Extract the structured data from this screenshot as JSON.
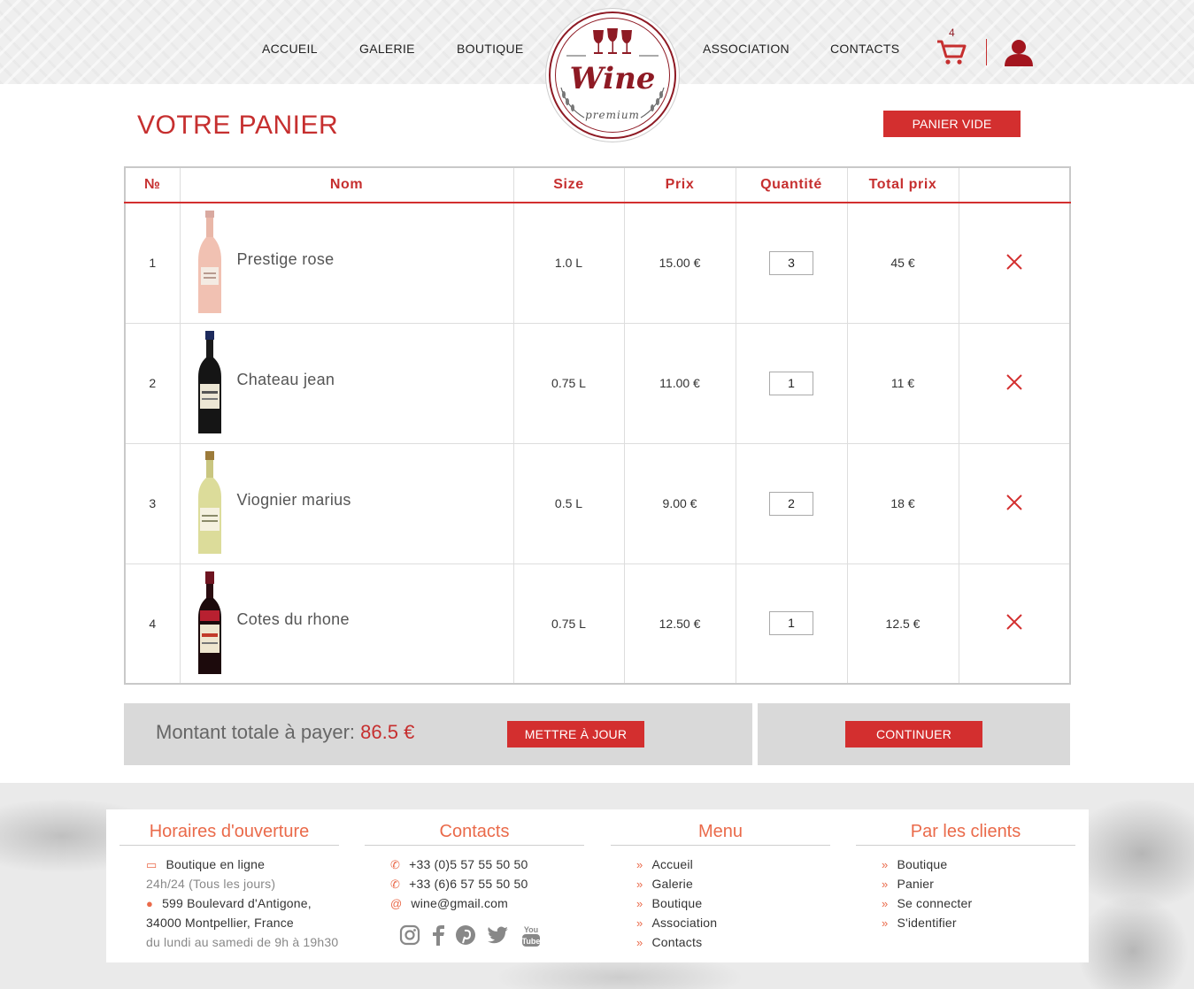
{
  "nav": {
    "accueil": "ACCUEIL",
    "galerie": "GALERIE",
    "boutique": "BOUTIQUE",
    "association": "ASSOCIATION",
    "contacts": "CONTACTS",
    "cart_count": "4"
  },
  "logo": {
    "word": "Wine",
    "sub": "premium"
  },
  "page": {
    "title": "VOTRE PANIER",
    "empty_button": "PANIER VIDE"
  },
  "table": {
    "headers": [
      "№",
      "Nom",
      "Size",
      "Prix",
      "Quantité",
      "Total prix",
      ""
    ],
    "rows": [
      {
        "no": "1",
        "name": "Prestige rose",
        "size": "1.0 L",
        "price": "15.00 €",
        "qty": "3",
        "total": "45 €"
      },
      {
        "no": "2",
        "name": "Chateau jean",
        "size": "0.75 L",
        "price": "11.00 €",
        "qty": "1",
        "total": "11 €"
      },
      {
        "no": "3",
        "name": "Viognier marius",
        "size": "0.5 L",
        "price": "9.00 €",
        "qty": "2",
        "total": "18 €"
      },
      {
        "no": "4",
        "name": "Cotes du rhone",
        "size": "0.75 L",
        "price": "12.50 €",
        "qty": "1",
        "total": "12.5 €"
      }
    ]
  },
  "summary": {
    "label": "Montant totale à payer: ",
    "amount": "86.5 €",
    "update_button": "METTRE À JOUR",
    "continue_button": "CONTINUER"
  },
  "footer": {
    "hours": {
      "title": "Horaires d'ouverture",
      "l1": "Boutique en ligne",
      "l2": "24h/24 (Tous les jours)",
      "l3": "599 Boulevard d'Antigone,",
      "l4": "34000 Montpellier, France",
      "l5": "du lundi au samedi de 9h à 19h30"
    },
    "contacts": {
      "title": "Contacts",
      "phone1": "+33 (0)5 57 55 50 50",
      "phone2": "+33 (6)6 57 55 50 50",
      "email": "wine@gmail.com"
    },
    "menu": {
      "title": "Menu",
      "items": [
        "Accueil",
        "Galerie",
        "Boutique",
        "Association",
        "Contacts"
      ]
    },
    "clients": {
      "title": "Par les clients",
      "items": [
        "Boutique",
        "Panier",
        "Se connecter",
        "S'identifier"
      ]
    }
  },
  "colors": {
    "accent": "#d32f2f",
    "brand": "#8e1a24",
    "footer_heading": "#ea6a4a"
  }
}
